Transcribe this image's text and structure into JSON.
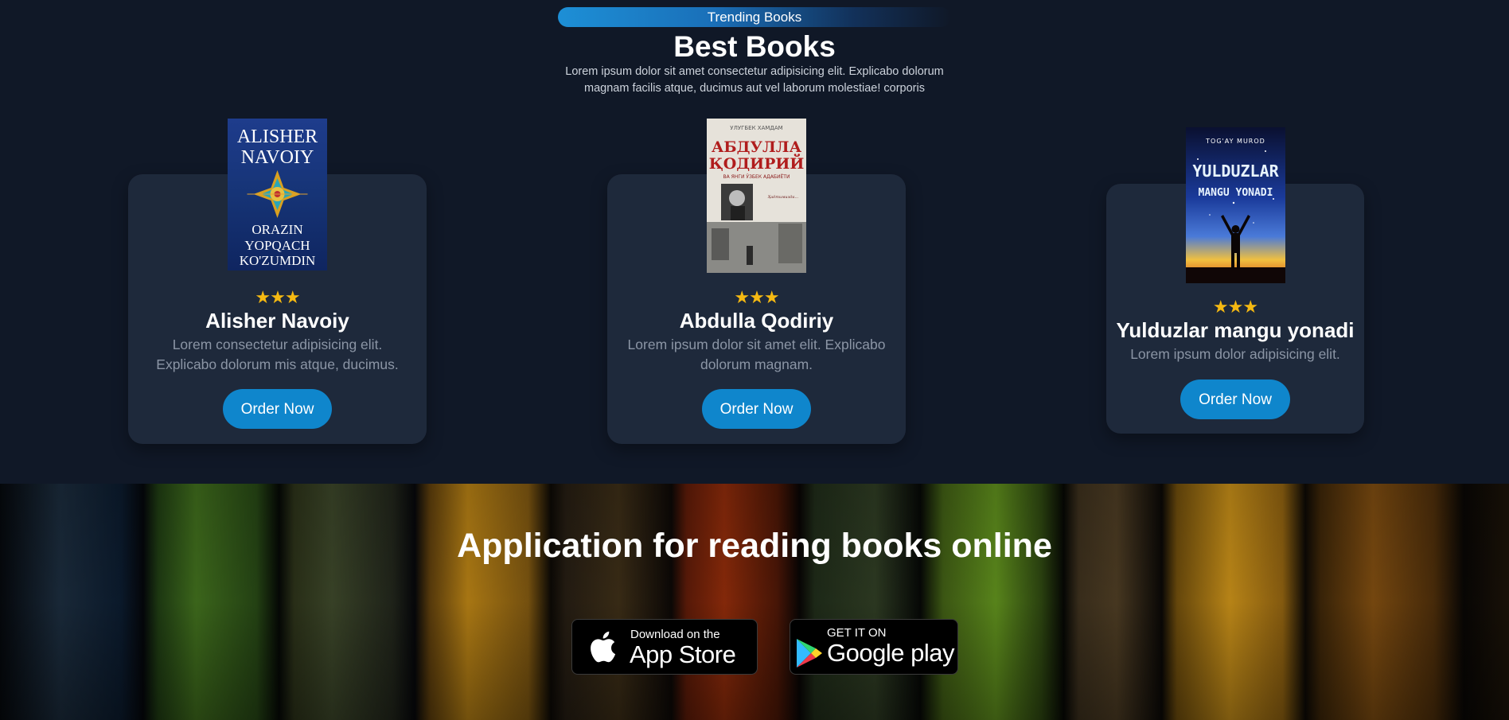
{
  "header": {
    "badge": "Trending Books",
    "title": "Best Books",
    "subtitle": "Lorem ipsum dolor sit amet consectetur adipisicing elit. Explicabo dolorum magnam facilis atque, ducimus aut vel laborum molestiae! corporis"
  },
  "books": [
    {
      "title": "Alisher Navoiy",
      "description": "Lorem consectetur adipisicing elit. Explicabo dolorum mis atque, ducimus.",
      "rating": 3,
      "stars": "★★★",
      "button": "Order Now",
      "cover": {
        "line1": "ALISHER",
        "line2": "NAVOIY",
        "line3": "ORAZIN",
        "line4": "YOPQACH",
        "line5": "KO'ZUMDIN"
      }
    },
    {
      "title": "Abdulla Qodiriy",
      "description": "Lorem ipsum dolor sit amet elit. Explicabo dolorum magnam.",
      "rating": 3,
      "stars": "★★★",
      "button": "Order Now",
      "cover": {
        "line1": "УЛУГБЕК ХАМДАМ",
        "line2": "АБДУЛЛА",
        "line3": "ҚОДИРИЙ",
        "line4": "ВА ЯНГИ ЎЗБЕК АДАБИЁТИ"
      }
    },
    {
      "title": "Yulduzlar mangu yonadi",
      "description": "Lorem ipsum dolor adipisicing elit.",
      "rating": 3,
      "stars": "★★★",
      "button": "Order Now",
      "cover": {
        "line1": "TOG'AY MUROD",
        "line2": "YULDUZLAR",
        "line3": "MANGU YONADI"
      }
    }
  ],
  "app_banner": {
    "title": "Application for reading books online",
    "app_store": {
      "small": "Download on the",
      "big": "App Store",
      "icon": "apple-icon"
    },
    "google_play": {
      "small": "GET IT ON",
      "big": "Google play",
      "icon": "google-play-icon"
    }
  }
}
